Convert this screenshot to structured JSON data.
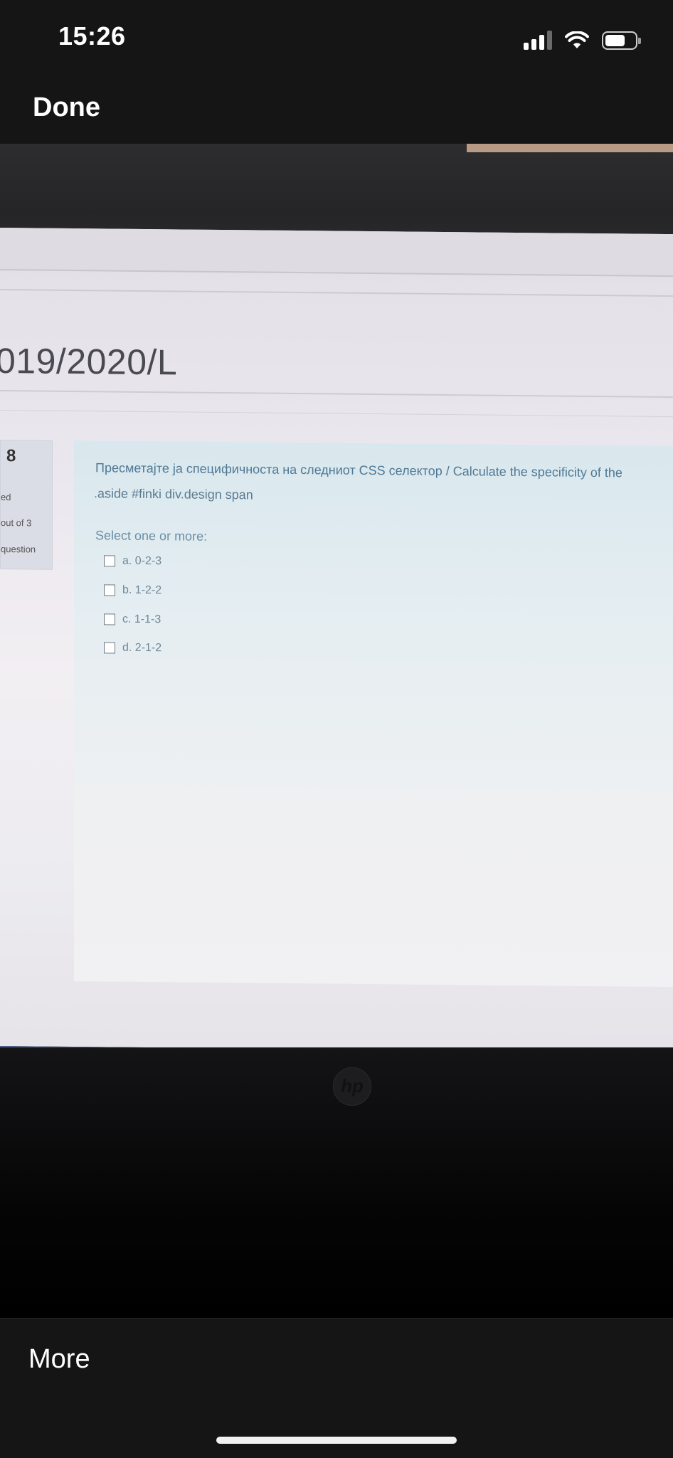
{
  "status_bar": {
    "time": "15:26",
    "signal_bars_on": 3,
    "signal_bars_total": 4,
    "battery_level": 0.65
  },
  "nav": {
    "done_label": "Done"
  },
  "photo": {
    "course_title": "019/2020/L",
    "info": {
      "question_number": "8",
      "status": "ed",
      "marks": "out of 3",
      "flag": "question"
    },
    "question": {
      "text": "Пресметајте ја специфичноста на следниот CSS селектор / Calculate the specificity of the",
      "selector": ".aside #finki div.design span",
      "prompt": "Select one or more:",
      "options": [
        {
          "label": "a. 0-2-3",
          "checked": false
        },
        {
          "label": "b. 1-2-2",
          "checked": false
        },
        {
          "label": "c. 1-1-3",
          "checked": false
        },
        {
          "label": "d. 2-1-2",
          "checked": false
        }
      ]
    },
    "laptop_logo": "hp"
  },
  "toolbar": {
    "more_label": "More"
  }
}
